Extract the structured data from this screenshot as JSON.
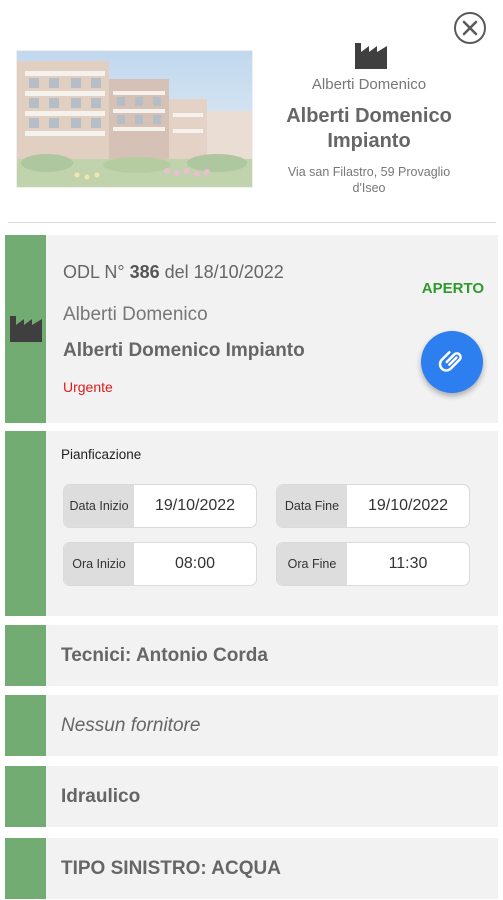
{
  "header": {
    "client_name": "Alberti Domenico",
    "plant_name": "Alberti Domenico Impianto",
    "address": "Via san Filastro, 59 Provaglio d'Iseo"
  },
  "order": {
    "prefix": "ODL N°",
    "number": "386",
    "date_text": "del 18/10/2022",
    "status": "APERTO",
    "client_name": "Alberti Domenico",
    "plant_name": "Alberti Domenico Impianto",
    "urgency": "Urgente"
  },
  "planning": {
    "title": "Pianficazione",
    "start_date_label": "Data Inizio",
    "start_date": "19/10/2022",
    "end_date_label": "Data Fine",
    "end_date": "19/10/2022",
    "start_time_label": "Ora Inizio",
    "start_time": "08:00",
    "end_time_label": "Ora Fine",
    "end_time": "11:30"
  },
  "technicians": "Tecnici:  Antonio Corda",
  "supplier": "Nessun fornitore",
  "category": "Idraulico",
  "claim_type": "TIPO SINISTRO: ACQUA",
  "colors": {
    "accent_green": "#72ac72",
    "status_green": "#2e9a2e",
    "urgent_red": "#e01b1b",
    "fab_blue": "#2d7ff0"
  },
  "icons": [
    "close-icon",
    "factory-icon",
    "paperclip-icon"
  ]
}
